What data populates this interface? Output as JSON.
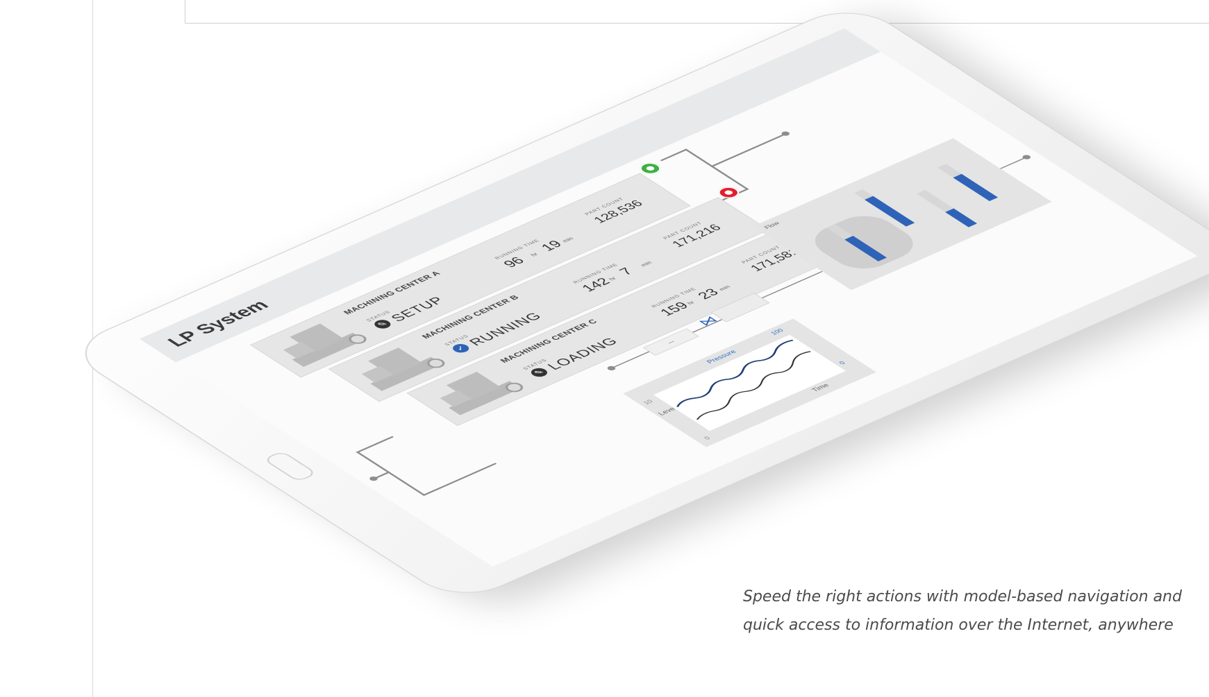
{
  "app": {
    "title": "LP System"
  },
  "machines": [
    {
      "name": "MACHINING CENTER A",
      "status_label": "STATUS",
      "status": "SETUP",
      "status_color": "#333333",
      "running_time_label": "RUNNING TIME",
      "running_hours": "96",
      "hours_unit": "hr",
      "running_minutes": "19",
      "minutes_unit": "min",
      "part_count_label": "PART COUNT",
      "part_count": "128,536",
      "indicator_color": "#3cb043"
    },
    {
      "name": "MACHINING CENTER B",
      "status_label": "STATUS",
      "status": "RUNNING",
      "status_color": "#2e63b8",
      "running_time_label": "RUNNING TIME",
      "running_hours": "142",
      "hours_unit": "hr",
      "running_minutes": "7",
      "minutes_unit": "min",
      "part_count_label": "PART COUNT",
      "part_count": "171,216",
      "indicator_color": "#e0202e"
    },
    {
      "name": "MACHINING CENTER C",
      "status_label": "STATUS",
      "status": "LOADING",
      "status_color": "#333333",
      "running_time_label": "RUNNING TIME",
      "running_hours": "159",
      "hours_unit": "hr",
      "running_minutes": "23",
      "minutes_unit": "min",
      "part_count_label": "PART COUNT",
      "part_count": "171,581",
      "indicator_color": "#3cb043"
    }
  ],
  "chart": {
    "left_label": "Level",
    "top_label": "Pressure",
    "bottom_label": "Time",
    "top_max": "100",
    "left_max": "10",
    "right_min": "0",
    "bottom_min": "0"
  },
  "tank": {
    "title": "Flow",
    "levels": [
      0.65,
      0.8,
      0.45,
      0.7
    ]
  },
  "caption": {
    "line1": "Speed the right actions with model-based navigation and",
    "line2": "quick access to information over the Internet, anywhere"
  }
}
